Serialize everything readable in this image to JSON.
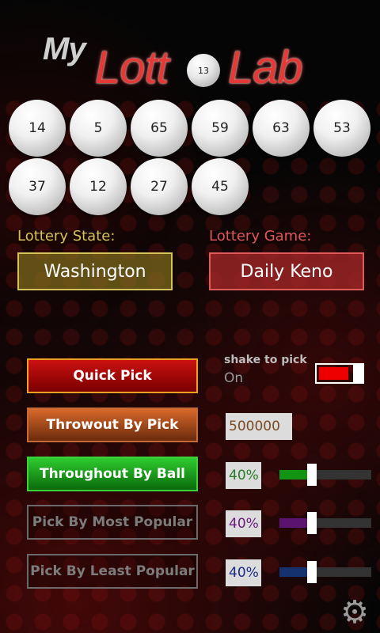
{
  "app": {
    "logo_my": "My",
    "logo_lotto": "Lott",
    "logo_ball": "13",
    "logo_lab": "Lab"
  },
  "balls": [
    "14",
    "5",
    "65",
    "59",
    "63",
    "53",
    "37",
    "12",
    "27",
    "45"
  ],
  "lottery": {
    "state_label": "Lottery State:",
    "state_value": "Washington",
    "game_label": "Lottery Game:",
    "game_value": "Daily Keno"
  },
  "actions": {
    "quick_pick": "Quick Pick",
    "throwout_by_pick": "Throwout By Pick",
    "throughout_by_ball": "Throughout By Ball",
    "pick_most_popular": "Pick By Most Popular",
    "pick_least_popular": "Pick By Least Popular"
  },
  "shake": {
    "title": "shake to pick",
    "state": "On",
    "enabled": true
  },
  "settings": {
    "throwout_value": "500000",
    "ball_percent": "40%",
    "most_popular_percent": "40%",
    "least_popular_percent": "40%",
    "ball_slider_level": 0.35,
    "most_popular_slider_level": 0.35,
    "least_popular_slider_level": 0.35
  },
  "colors": {
    "accent_red": "#e53935",
    "state_yellow": "#d4c25a",
    "green": "#139313",
    "purple": "#5a1470",
    "blue": "#16326e"
  },
  "icons": {
    "settings": "gear-icon"
  }
}
